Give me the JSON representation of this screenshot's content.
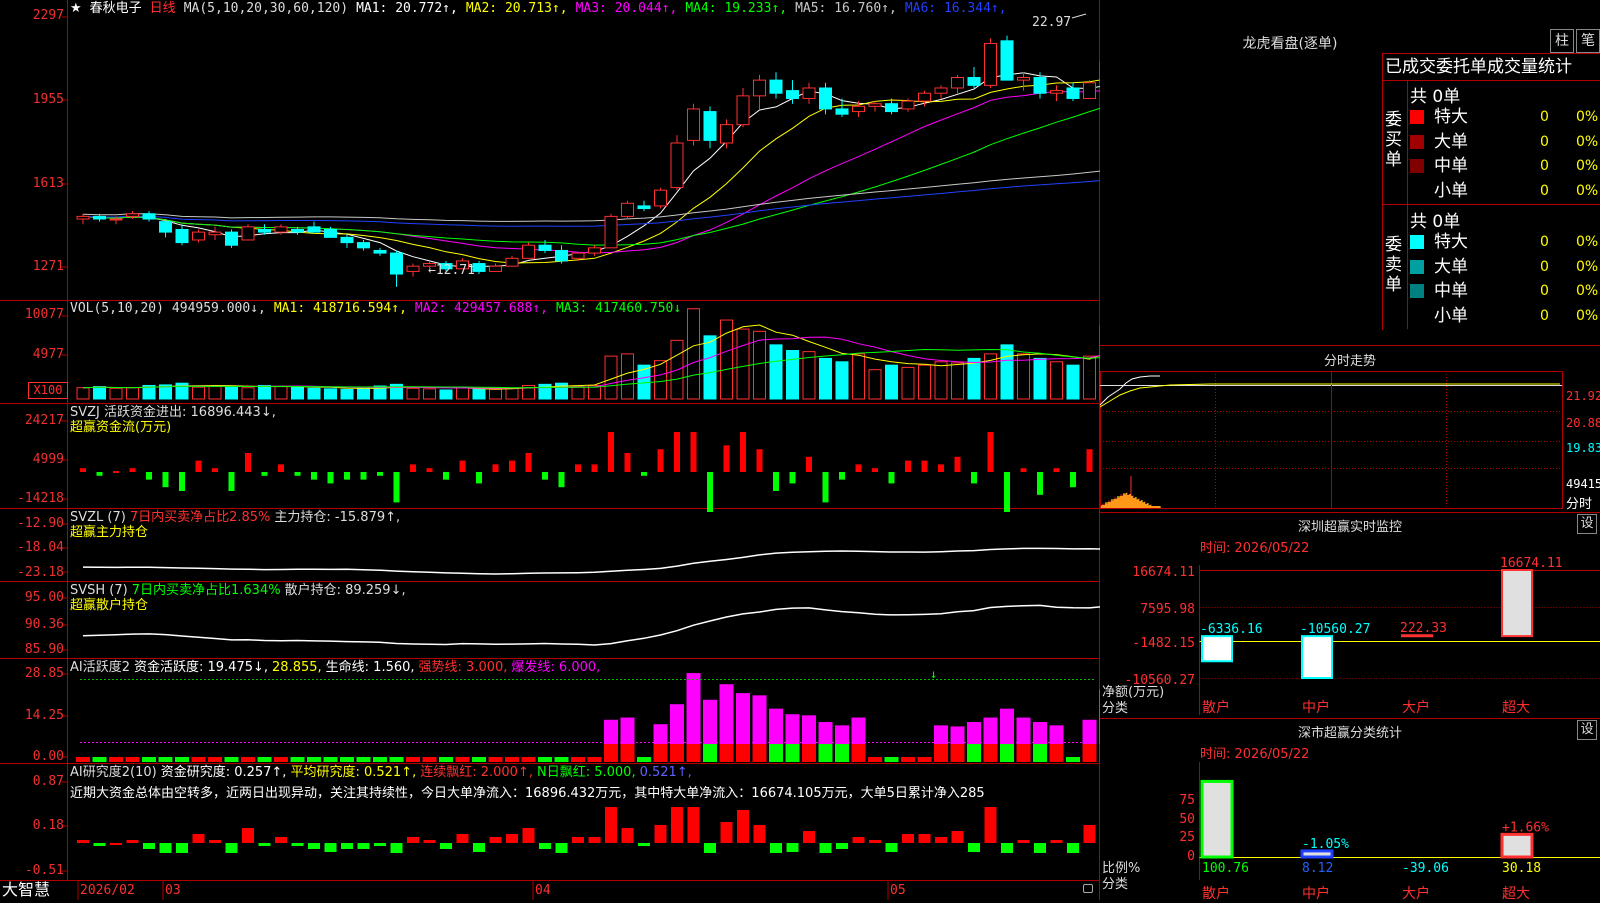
{
  "stock": {
    "star": "★",
    "name": "春秋电子",
    "period": "日线",
    "ma_label": "MA(5,10,20,30,60,120)",
    "ma": [
      {
        "label": "MA1:",
        "value": "20.772↑",
        "color": "#ffffff"
      },
      {
        "label": "MA2:",
        "value": "20.713↑",
        "color": "#ffff00"
      },
      {
        "label": "MA3:",
        "value": "20.044↑",
        "color": "#ff00ff"
      },
      {
        "label": "MA4:",
        "value": "19.233↑",
        "color": "#00ff00"
      },
      {
        "label": "MA5:",
        "value": "16.760↑",
        "color": "#c8c8c8"
      },
      {
        "label": "MA6:",
        "value": "16.344↑",
        "color": "#2040ff"
      }
    ],
    "high_mark": "22.97",
    "low_mark": "12.71",
    "price_ticks": [
      "2297",
      "1955",
      "1613",
      "1271"
    ]
  },
  "vol": {
    "label": "VOL(5,10,20)",
    "value": "494959.000↓,",
    "ma": [
      {
        "text": "MA1: 418716.594↑,",
        "color": "#ffff00"
      },
      {
        "text": "MA2: 429457.688↑,",
        "color": "#ff00ff"
      },
      {
        "text": "MA3: 417460.750↓",
        "color": "#00ff00"
      }
    ],
    "ticks": [
      "10077",
      "4977"
    ],
    "unit": "X100"
  },
  "svzj": {
    "label": "SVZJ 活跃资金进出: 16896.443↓,",
    "sub": "超赢资金流(万元)",
    "ticks": [
      "24217",
      "4999",
      "-14218"
    ]
  },
  "svzl": {
    "label": "SVZL (7)",
    "ratio": "7日内买卖净占比2.85%",
    "hold": "主力持仓: -15.879↑,",
    "sub": "超赢主力持仓",
    "ticks": [
      "-12.90",
      "-18.04",
      "-23.18"
    ]
  },
  "svsh": {
    "label": "SVSH (7)",
    "ratio": "7日内买卖净占比1.634%",
    "hold": "散户持仓: 89.259↓,",
    "sub": "超赢散户持仓",
    "ticks": [
      "95.00",
      "90.36",
      "85.90"
    ]
  },
  "ai1": {
    "label": "AI活跃度2",
    "items": [
      {
        "text": "资金活跃度: 19.475↓,",
        "color": "#ffffff"
      },
      {
        "text": "28.855,",
        "color": "#ffff00"
      },
      {
        "text": "生命线: 1.560,",
        "color": "#ffffff"
      },
      {
        "text": "强势线: 3.000,",
        "color": "#ff3030"
      },
      {
        "text": "爆发线: 6.000,",
        "color": "#ff00ff"
      }
    ],
    "ticks": [
      "28.85",
      "14.25",
      "0.00"
    ]
  },
  "ai2": {
    "label": "AI研究度2(10)",
    "items": [
      {
        "text": "资金研究度: 0.257↑,",
        "color": "#ffffff"
      },
      {
        "text": "平均研究度: 0.521↑,",
        "color": "#ffff00"
      },
      {
        "text": "连续飘红: 2.000↑,",
        "color": "#ff3030"
      },
      {
        "text": "N日飘红: 5.000,",
        "color": "#00ff00"
      },
      {
        "text": "0.521↑,",
        "color": "#6060ff"
      }
    ],
    "note": "近期大资金总体由空转多，近两日出现异动，关注其持续性，今日大单净流入：16896.432万元，其中特大单净流入：16674.105万元，大单5日累计净入285",
    "ticks": [
      "0.87",
      "0.18",
      "-0.51"
    ]
  },
  "timeline": {
    "brand": "大智慧",
    "labels": [
      "2026/02",
      "03",
      "04",
      "05"
    ]
  },
  "right": {
    "longhu_title": "龙虎看盘(逐单)",
    "btn_bar": "柱",
    "btn_pen": "笔",
    "table_title": "已成交委托单成交量统计",
    "buy_side": "委买单",
    "sell_side": "委卖单",
    "buy_total": "共 0单",
    "sell_total": "共 0单",
    "buy_rows": [
      {
        "label": "特大",
        "val": "0",
        "pct": "0%",
        "color": "#ff0000"
      },
      {
        "label": "大单",
        "val": "0",
        "pct": "0%",
        "color": "#a00000"
      },
      {
        "label": "中单",
        "val": "0",
        "pct": "0%",
        "color": "#800000"
      },
      {
        "label": "小单",
        "val": "0",
        "pct": "0%",
        "color": ""
      }
    ],
    "sell_rows": [
      {
        "label": "特大",
        "val": "0",
        "pct": "0%",
        "color": "#00ffff"
      },
      {
        "label": "大单",
        "val": "0",
        "pct": "0%",
        "color": "#00a0a0"
      },
      {
        "label": "中单",
        "val": "0",
        "pct": "0%",
        "color": "#008080"
      },
      {
        "label": "小单",
        "val": "0",
        "pct": "0%",
        "color": ""
      }
    ],
    "intraday_title": "分时走势",
    "intraday_ticks": [
      "21.92",
      "20.88",
      "19.83",
      "49415",
      "分时"
    ],
    "sz_title": "深圳超赢实时监控",
    "sz_btn": "设",
    "sz_time": "时间: 2026/05/22",
    "sz_ticks": [
      "16674.11",
      "7595.98",
      "-1482.15",
      "-10560.27"
    ],
    "sz_axis": "净额(万元)",
    "sz_axis2": "分类",
    "sz_categories": [
      "散户",
      "中户",
      "大户",
      "超大"
    ],
    "sz_values": [
      "-6336.16",
      "-10560.27",
      "222.33",
      "16674.11"
    ],
    "cls_title": "深市超赢分类统计",
    "cls_btn": "设",
    "cls_time": "时间: 2026/05/22",
    "cls_ticks": [
      "75",
      "50",
      "25",
      "0"
    ],
    "cls_axis": "比例%",
    "cls_axis2": "分类",
    "cls_categories": [
      "散户",
      "中户",
      "大户",
      "超大"
    ],
    "cls_values": [
      "100.76",
      "8.12",
      "-39.06",
      "30.18"
    ],
    "cls_deltas": [
      "",
      "-1.05%",
      "",
      "+1.66%"
    ]
  },
  "chart_data": [
    {
      "type": "candlestick",
      "title": "春秋电子 日线",
      "series": [
        {
          "name": "OHLC",
          "values": [
            [
              15.3,
              15.5,
              15.1,
              15.4
            ],
            [
              15.4,
              15.5,
              15.2,
              15.3
            ],
            [
              15.3,
              15.4,
              15.1,
              15.3
            ],
            [
              15.4,
              15.6,
              15.3,
              15.5
            ],
            [
              15.5,
              15.6,
              15.2,
              15.3
            ],
            [
              15.2,
              15.3,
              14.6,
              14.8
            ],
            [
              14.9,
              15.1,
              14.3,
              14.4
            ],
            [
              14.5,
              14.9,
              14.4,
              14.8
            ],
            [
              14.7,
              15.0,
              14.5,
              14.8
            ],
            [
              14.8,
              14.9,
              14.2,
              14.3
            ],
            [
              14.5,
              15.1,
              14.5,
              15.0
            ],
            [
              14.9,
              15.1,
              14.7,
              14.8
            ],
            [
              14.8,
              15.1,
              14.7,
              15.0
            ],
            [
              14.9,
              15.0,
              14.7,
              14.8
            ],
            [
              15.0,
              15.2,
              14.8,
              14.8
            ],
            [
              14.9,
              15.0,
              14.6,
              14.6
            ],
            [
              14.6,
              14.7,
              14.2,
              14.4
            ],
            [
              14.4,
              14.5,
              14.1,
              14.2
            ],
            [
              14.1,
              14.2,
              13.9,
              14.0
            ],
            [
              14.0,
              14.1,
              12.71,
              13.2
            ],
            [
              13.3,
              13.6,
              13.1,
              13.5
            ],
            [
              13.5,
              13.7,
              13.4,
              13.6
            ],
            [
              13.6,
              13.7,
              13.3,
              13.4
            ],
            [
              13.4,
              13.8,
              13.4,
              13.7
            ],
            [
              13.6,
              13.7,
              13.2,
              13.3
            ],
            [
              13.3,
              13.6,
              13.3,
              13.5
            ],
            [
              13.5,
              13.9,
              13.5,
              13.8
            ],
            [
              13.8,
              14.4,
              13.8,
              14.3
            ],
            [
              14.3,
              14.5,
              14.0,
              14.1
            ],
            [
              14.1,
              14.3,
              13.6,
              13.7
            ],
            [
              13.8,
              14.0,
              13.7,
              14.0
            ],
            [
              14.0,
              14.3,
              13.9,
              14.2
            ],
            [
              14.2,
              15.5,
              14.2,
              15.4
            ],
            [
              15.4,
              16.0,
              15.3,
              15.9
            ],
            [
              15.8,
              16.0,
              15.6,
              15.7
            ],
            [
              15.8,
              16.5,
              15.7,
              16.4
            ],
            [
              16.5,
              18.5,
              16.4,
              18.2
            ],
            [
              18.3,
              19.7,
              18.1,
              19.5
            ],
            [
              19.4,
              19.6,
              18.0,
              18.3
            ],
            [
              18.2,
              19.1,
              18.0,
              18.9
            ],
            [
              18.9,
              20.3,
              18.8,
              20.0
            ],
            [
              20.0,
              20.8,
              19.5,
              20.6
            ],
            [
              20.6,
              20.9,
              19.9,
              20.1
            ],
            [
              20.2,
              20.6,
              19.7,
              19.9
            ],
            [
              19.9,
              20.5,
              19.7,
              20.3
            ],
            [
              20.3,
              20.5,
              19.3,
              19.5
            ],
            [
              19.5,
              19.9,
              19.2,
              19.3
            ],
            [
              19.4,
              19.8,
              19.2,
              19.6
            ],
            [
              19.6,
              19.8,
              19.4,
              19.7
            ],
            [
              19.7,
              19.9,
              19.3,
              19.4
            ],
            [
              19.5,
              19.9,
              19.4,
              19.8
            ],
            [
              19.8,
              20.2,
              19.6,
              20.1
            ],
            [
              20.1,
              20.4,
              19.9,
              20.3
            ],
            [
              20.3,
              20.8,
              20.1,
              20.7
            ],
            [
              20.7,
              21.1,
              20.3,
              20.4
            ],
            [
              20.4,
              22.2,
              20.3,
              22.0
            ],
            [
              22.1,
              22.3,
              20.6,
              20.6
            ],
            [
              20.6,
              20.9,
              20.2,
              20.7
            ],
            [
              20.7,
              20.9,
              19.9,
              20.1
            ],
            [
              20.1,
              20.4,
              19.8,
              20.2
            ],
            [
              20.3,
              20.5,
              19.8,
              19.9
            ],
            [
              19.9,
              20.6,
              19.9,
              20.5
            ],
            [
              20.5,
              21.5,
              20.4,
              21.3
            ],
            [
              21.3,
              22.97,
              21.2,
              22.9
            ]
          ]
        }
      ],
      "ylim": [
        12.4,
        23.2
      ]
    },
    {
      "type": "bar",
      "title": "VOL(5,10,20)",
      "unit": "X100",
      "values": [
        100,
        110,
        95,
        100,
        120,
        125,
        140,
        105,
        110,
        115,
        100,
        120,
        110,
        105,
        95,
        90,
        85,
        95,
        115,
        130,
        95,
        90,
        80,
        100,
        90,
        85,
        95,
        120,
        130,
        140,
        110,
        120,
        380,
        400,
        300,
        340,
        520,
        800,
        560,
        700,
        620,
        600,
        480,
        430,
        420,
        360,
        330,
        400,
        260,
        300,
        280,
        300,
        330,
        320,
        360,
        400,
        480,
        400,
        360,
        330,
        300,
        380,
        650,
        494.959
      ],
      "ylim": [
        0,
        860
      ]
    }
  ]
}
